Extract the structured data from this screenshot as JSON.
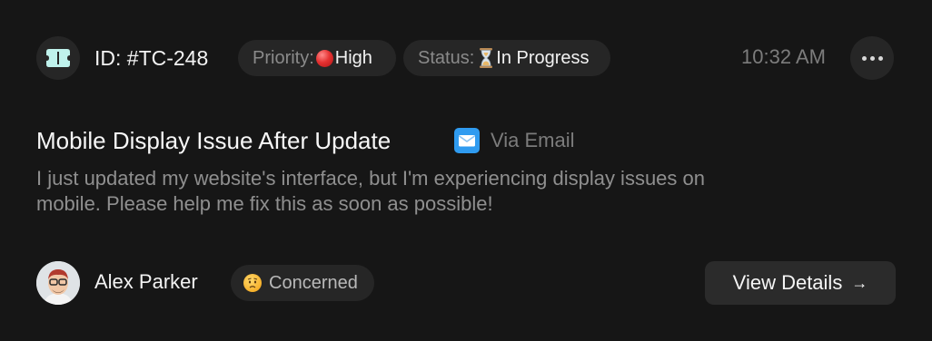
{
  "ticket": {
    "id_label": "ID: #TC-248",
    "priority_key": "Priority:",
    "priority_value": "High",
    "status_key": "Status:",
    "status_value": "In Progress",
    "time": "10:32 AM"
  },
  "content": {
    "title": "Mobile Display Issue After Update",
    "channel": "Via Email",
    "message": "I just updated my website's interface, but I'm experiencing display issues on mobile. Please help me fix this as soon as possible!"
  },
  "customer": {
    "name": "Alex Parker",
    "sentiment": "Concerned"
  },
  "actions": {
    "view_details": "View Details",
    "arrow": "→"
  },
  "icons": {
    "ticket": "ticket-icon",
    "priority": "red-circle-icon",
    "status": "hourglass-icon",
    "channel": "envelope-icon",
    "sentiment": "worried-face-icon",
    "more": "more-horizontal-icon"
  },
  "colors": {
    "background": "#161616",
    "pill": "#262626",
    "ticket_icon": "#bff2ec",
    "priority_red": "#e53232",
    "mail_blue": "#2f9bf0",
    "muted_text": "#8a8a8a"
  }
}
